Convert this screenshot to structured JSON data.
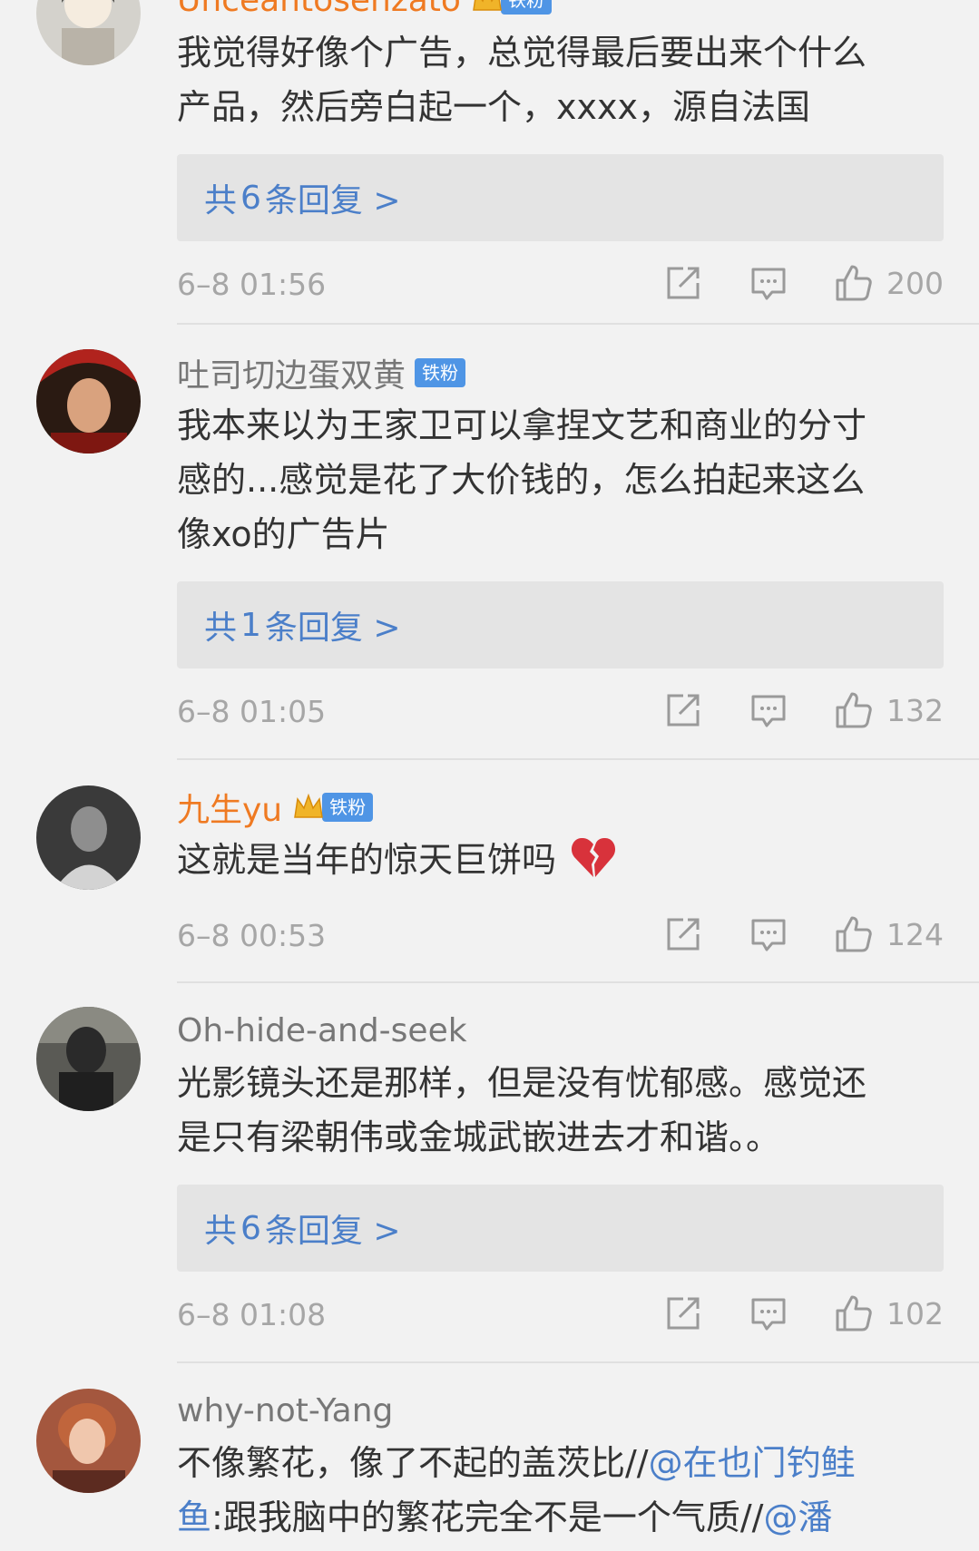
{
  "comments": [
    {
      "username": "Unceantosenzato",
      "badge": "铁粉",
      "lines": [
        "我觉得好像个广告，总觉得最后要出来个什么",
        "产品，然后旁白起一个，xxxx，源自法国"
      ],
      "replies": {
        "prefix": "共",
        "count": "6",
        "suffix": "条回复 >"
      },
      "timestamp": "6–8 01:56",
      "likes": "200"
    },
    {
      "username": "吐司切边蛋双黄",
      "badge": "铁粉",
      "lines": [
        "我本来以为王家卫可以拿捏文艺和商业的分寸",
        "感的...感觉是花了大价钱的，怎么拍起来这么",
        "像xo的广告片"
      ],
      "replies": {
        "prefix": "共",
        "count": "1",
        "suffix": "条回复 >"
      },
      "timestamp": "6–8 01:05",
      "likes": "132"
    },
    {
      "username": "九生yu",
      "badge": "铁粉",
      "lines": [
        "这就是当年的惊天巨饼吗"
      ],
      "timestamp": "6–8 00:53",
      "likes": "124"
    },
    {
      "username": "Oh-hide-and-seek",
      "lines": [
        "光影镜头还是那样，但是没有忧郁感。感觉还",
        "是只有梁朝伟或金城武嵌进去才和谐。。"
      ],
      "replies": {
        "prefix": "共",
        "count": "6",
        "suffix": "条回复 >"
      },
      "timestamp": "6–8 01:08",
      "likes": "102"
    },
    {
      "username": "why-not-Yang",
      "line1_text": "不像繁花，像了不起的盖茨比//",
      "line1_mention": "@在也门钓鲑",
      "line2_mention": "鱼",
      "line2_text": ":跟我脑中的繁花完全不是一个气质//",
      "line2_mention2": "@潘"
    }
  ],
  "icons": {
    "share": "share-icon",
    "reply": "comment-icon",
    "like": "thumbs-up-icon",
    "emoji": "broken-heart-emoji",
    "crown": "crown-icon"
  },
  "colors": {
    "background": "#f2f2f2",
    "reply_box": "#e4e4e4",
    "link": "#4b7fc9",
    "vip_name": "#ef7a22",
    "badge": "#4f95e5"
  }
}
